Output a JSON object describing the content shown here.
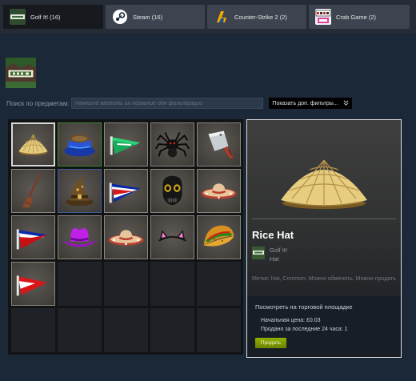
{
  "tabs": [
    {
      "label": "Golf It! (16)",
      "icon": "golf-it-icon",
      "active": true
    },
    {
      "label": "Steam (16)",
      "icon": "steam-icon",
      "active": false
    },
    {
      "label": "Counter-Strike 2 (2)",
      "icon": "counter-strike-icon",
      "active": false
    },
    {
      "label": "Crab Game (2)",
      "icon": "crab-game-icon",
      "active": false
    }
  ],
  "search": {
    "label": "Поиск по предметам:",
    "placeholder": "Начните вводить их название для фильтрации",
    "filter_button": "Показать доп. фильтры...",
    "filter_icon": "double-chevron-down-icon"
  },
  "inventory": {
    "items": [
      {
        "name": "rice-hat",
        "border": "default"
      },
      {
        "name": "blue-bowl-hat",
        "border": "green"
      },
      {
        "name": "green-pennant",
        "border": "default"
      },
      {
        "name": "spider",
        "border": "default"
      },
      {
        "name": "cleaver",
        "border": "default"
      },
      {
        "name": "broom",
        "border": "default"
      },
      {
        "name": "wizard-hat",
        "border": "blue"
      },
      {
        "name": "costa-rica-flag",
        "border": "default"
      },
      {
        "name": "skull-mask",
        "border": "default"
      },
      {
        "name": "sombrero",
        "border": "default"
      },
      {
        "name": "france-flag",
        "border": "default"
      },
      {
        "name": "purple-cowboy-hat",
        "border": "default"
      },
      {
        "name": "sombrero-2",
        "border": "default"
      },
      {
        "name": "cat-ears",
        "border": "default"
      },
      {
        "name": "taco",
        "border": "default"
      },
      {
        "name": "red-white-flag",
        "border": "default"
      }
    ],
    "empty_slots": 9
  },
  "detail": {
    "name": "Rice Hat",
    "game": "Golf It!",
    "type": "Hat",
    "tags": "Метки: Hat, Common, Можно обменять, Можно продать",
    "market_link": "Посмотреть на торговой площадке",
    "start_price": "Начальная цена: £0.03",
    "sold_24h": "Продано за последние 24 часа: 1",
    "sell_button": "Продать"
  },
  "colors": {
    "background": "#1b2838",
    "sell_button": "#7a9a00",
    "green_border": "#3f8b2c",
    "blue_border": "#3d5a9a"
  }
}
